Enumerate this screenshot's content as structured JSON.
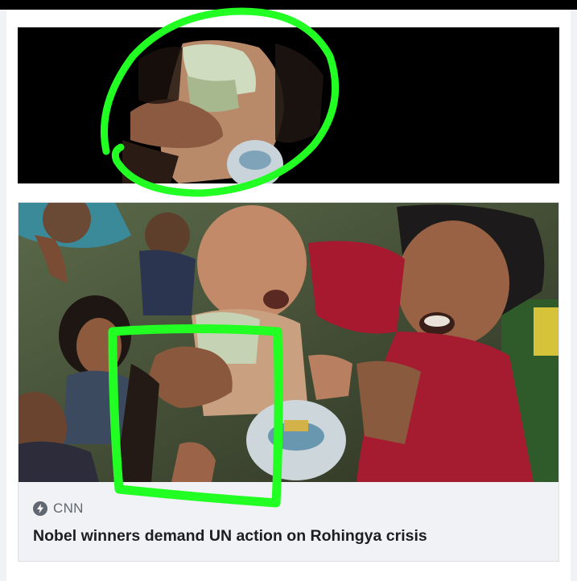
{
  "post": {
    "link_preview": {
      "source": "CNN",
      "source_icon": "lightning-bolt-icon",
      "headline": "Nobel winners demand UN action on Rohingya crisis"
    }
  },
  "annotations": {
    "color": "#22ff22"
  }
}
